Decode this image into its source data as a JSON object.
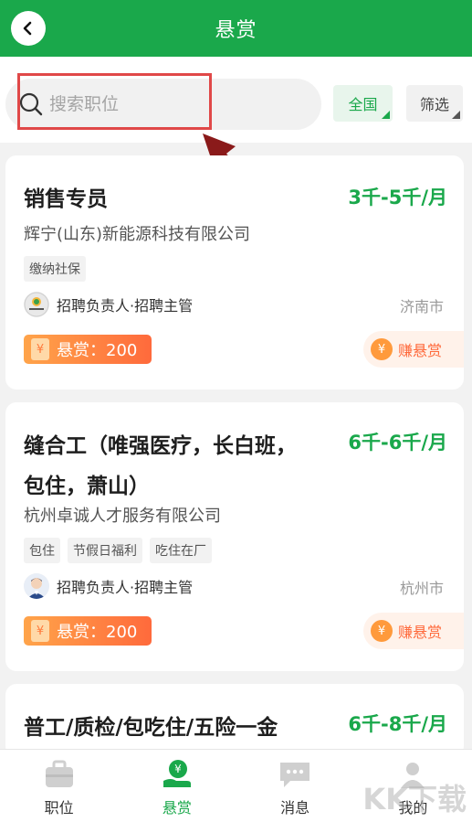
{
  "header": {
    "title": "悬赏"
  },
  "search": {
    "placeholder": "搜索职位"
  },
  "filters": {
    "region": "全国",
    "screen": "筛选"
  },
  "jobs": [
    {
      "title": "销售专员",
      "salary": "3千-5千/月",
      "company": "辉宁(山东)新能源科技有限公司",
      "tags": [
        "缴纳社保"
      ],
      "recruiter": "招聘负责人·招聘主管",
      "city": "济南市",
      "reward": "悬赏：200",
      "earn": "赚悬赏"
    },
    {
      "title_line1": "缝合工（唯强医疗，长白班，",
      "title_line2": "包住，萧山）",
      "salary": "6千-6千/月",
      "company": "杭州卓诚人才服务有限公司",
      "tags": [
        "包住",
        "节假日福利",
        "吃住在厂"
      ],
      "recruiter": "招聘负责人·招聘主管",
      "city": "杭州市",
      "reward": "悬赏：200",
      "earn": "赚悬赏"
    },
    {
      "title": "普工/质检/包吃住/五险一金",
      "salary": "6千-8千/月"
    }
  ],
  "nav": [
    {
      "label": "职位",
      "icon": "briefcase-icon"
    },
    {
      "label": "悬赏",
      "icon": "reward-hand-icon"
    },
    {
      "label": "消息",
      "icon": "message-icon"
    },
    {
      "label": "我的",
      "icon": "profile-icon"
    }
  ],
  "watermark": "KK下载",
  "colors": {
    "primary": "#1aa84b",
    "reward": "#ff6a3c",
    "highlight": "#e04848"
  }
}
